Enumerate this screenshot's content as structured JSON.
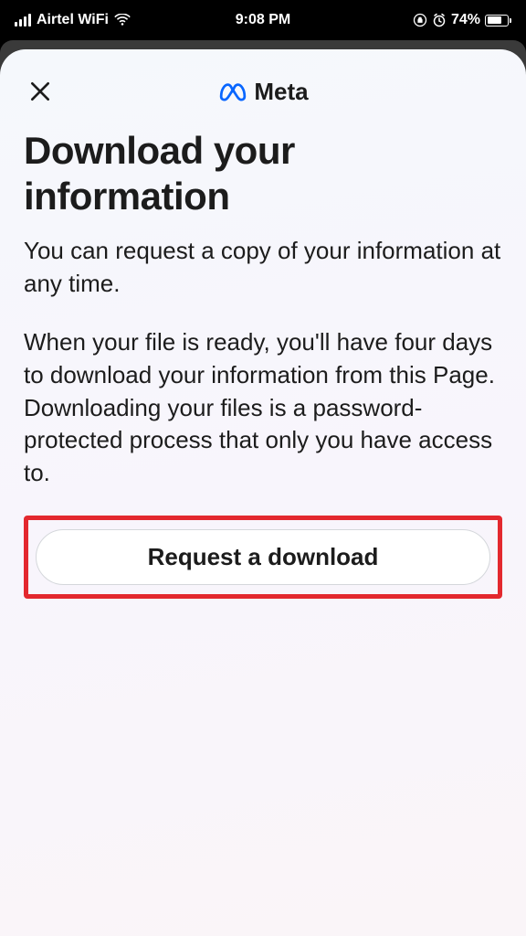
{
  "status_bar": {
    "carrier": "Airtel WiFi",
    "time": "9:08 PM",
    "battery_percent": "74%"
  },
  "header": {
    "logo_text": "Meta"
  },
  "content": {
    "title": "Download your information",
    "paragraph_1": "You can request a copy of your information at any time.",
    "paragraph_2": "When your file is ready, you'll have four days to download your information from this Page. Downloading your files is a password-protected process that only you have access to."
  },
  "actions": {
    "request_button": "Request a download"
  }
}
